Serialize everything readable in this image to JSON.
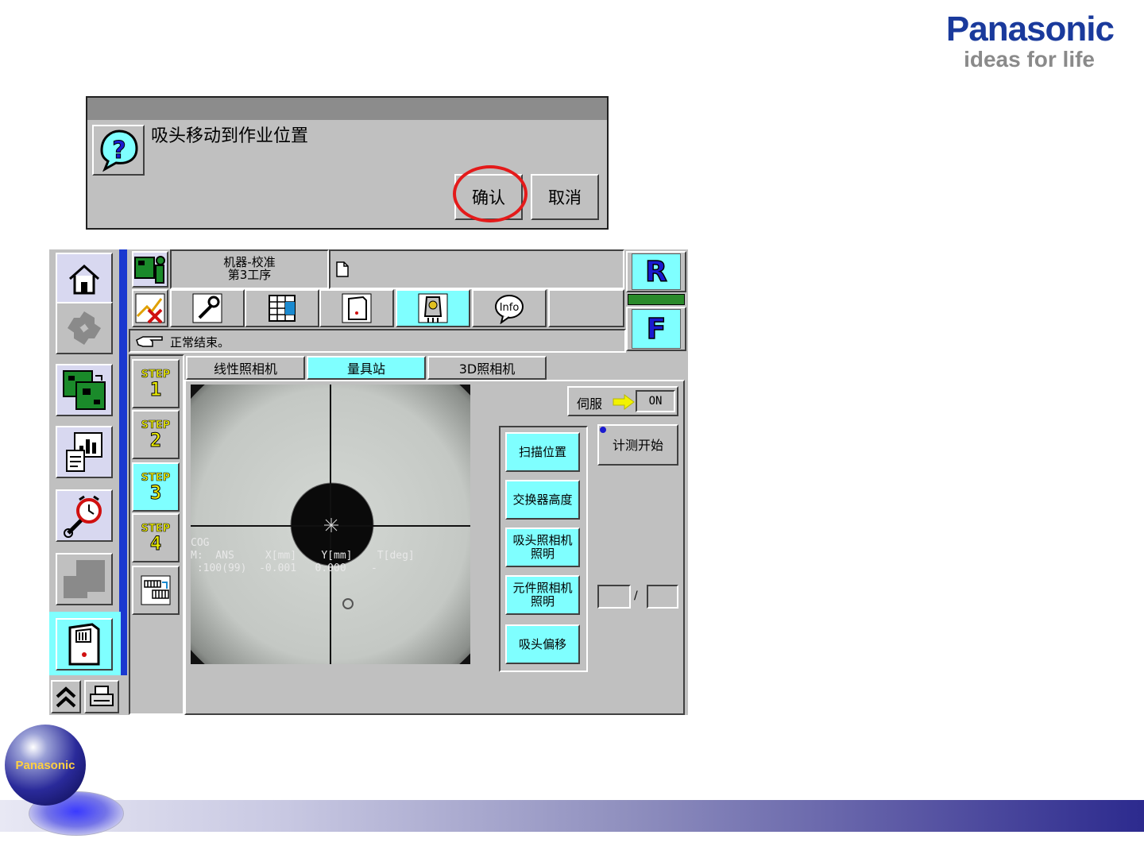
{
  "brand": {
    "name": "Panasonic",
    "tagline": "ideas for life",
    "color": "#1a3a9c"
  },
  "dialog": {
    "message": "吸头移动到作业位置",
    "confirm_label": "确认",
    "cancel_label": "取消",
    "icon": "question-icon"
  },
  "app": {
    "header": {
      "line1": "机器-校准",
      "line2": "第3工序"
    },
    "status_message": "正常结束。",
    "sub_tabs": [
      "线性照相机",
      "量具站",
      "3D照相机"
    ],
    "active_sub_tab": 1,
    "steps": [
      {
        "label": "STEP",
        "num": "1"
      },
      {
        "label": "STEP",
        "num": "2"
      },
      {
        "label": "STEP",
        "num": "3"
      },
      {
        "label": "STEP",
        "num": "4"
      }
    ],
    "active_step": 2,
    "servo": {
      "label": "伺服",
      "value": "ON"
    },
    "measure_start": "计测开始",
    "actions": [
      "扫描位置",
      "交换器高度",
      "吸头照相机\n照明",
      "元件照相机\n照明",
      "吸头偏移"
    ],
    "page_sep": "/",
    "camera": {
      "cog": "COG",
      "row_labels": "M:  ANS     X[mm]    Y[mm]    T[deg]",
      "row_values": " :100(99)  -0.001   0.000    -"
    },
    "right_buttons": {
      "r": "R",
      "f": "F"
    },
    "info_label": "Info"
  },
  "colors": {
    "accent_cyan": "#7fffff",
    "panel_gray": "#c0c0c0",
    "left_blue": "#1a38d0",
    "highlight_red": "#e41a1a"
  }
}
